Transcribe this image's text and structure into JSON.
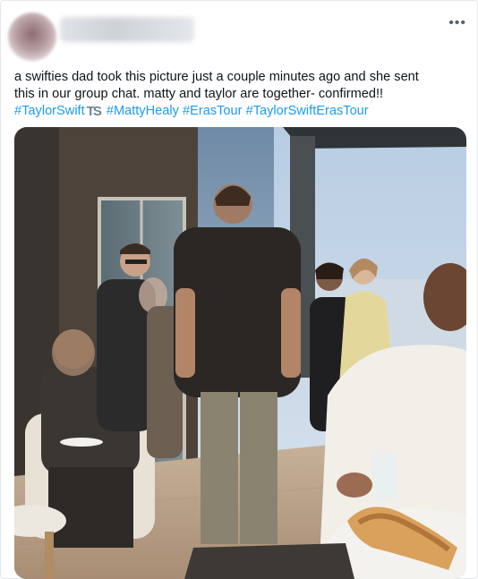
{
  "tweet": {
    "author_name": "",
    "more_icon": "more-horizontal-icon",
    "text_line1": "a swifties dad took this picture just a couple minutes ago and she sent",
    "text_line2": "this in our group chat. matty and taylor are together- confirmed!!",
    "hashtags": [
      "#TaylorSwift",
      "#MattyHealy",
      "#ErasTour",
      "#TaylorSwiftErasTour"
    ],
    "ts_emoji": "TS",
    "photo_subject": "rooftop-gathering-photo"
  },
  "colors": {
    "link": "#1d9bf0",
    "text": "#0f1419",
    "muted": "#536471"
  }
}
